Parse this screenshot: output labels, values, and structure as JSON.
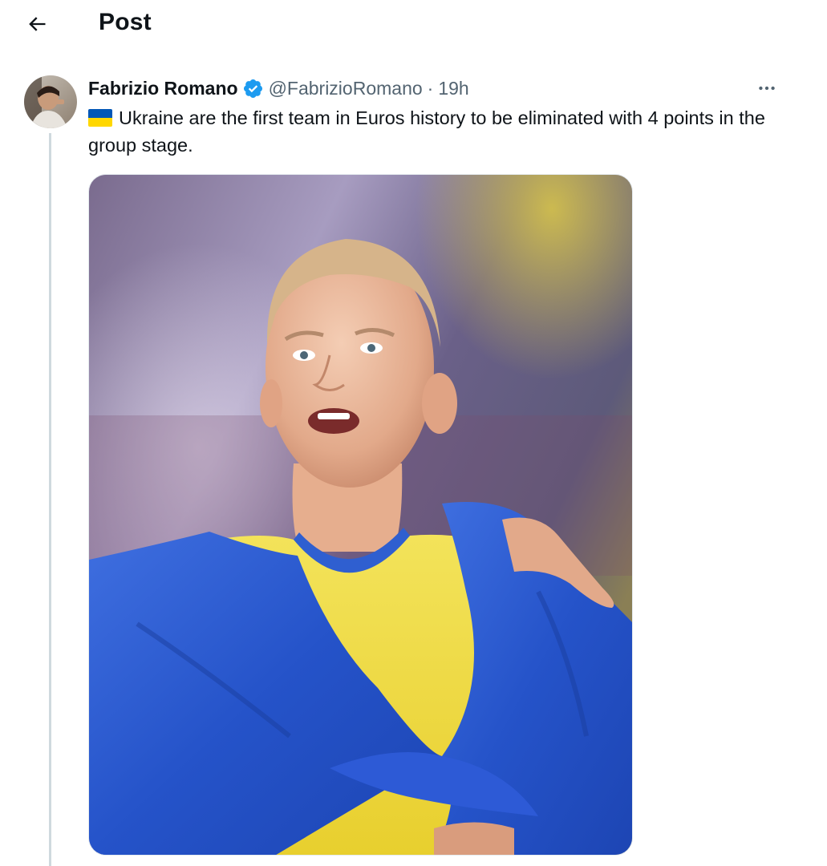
{
  "header": {
    "back_icon": "arrow-left-icon",
    "title": "Post"
  },
  "post": {
    "author": {
      "name": "Fabrizio Romano",
      "handle": "@FabrizioRomano",
      "verified_icon": "verified-badge-icon",
      "avatar_icon": "avatar-photo"
    },
    "separator": "·",
    "time": "19h",
    "more_icon": "more-horizontal-icon",
    "flag_icon": "ukraine-flag-emoji",
    "text": "Ukraine are the first team in Euros history to be eliminated with 4 points in the group stage.",
    "media_icon": "player-photo"
  },
  "colors": {
    "text_primary": "#0f1419",
    "text_secondary": "#536471",
    "verified_blue": "#1d9bf0",
    "thread_line": "#cfd9de",
    "flag_blue": "#0057b7",
    "flag_yellow": "#ffd700"
  }
}
